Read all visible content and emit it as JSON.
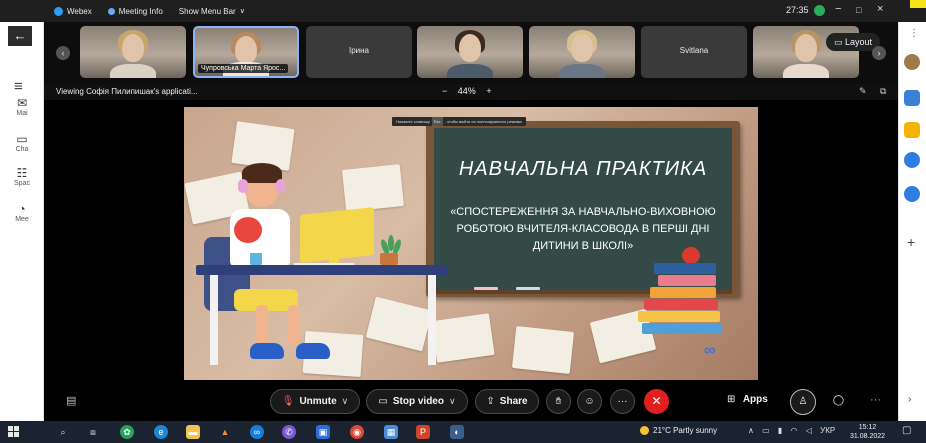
{
  "titlebar": {
    "app_name": "Webex",
    "meeting_info": "Meeting Info",
    "show_menu_bar": "Show Menu Bar",
    "timer": "27:35",
    "minimize_glyph": "−",
    "maximize_glyph": "□",
    "close_glyph": "×"
  },
  "participants": [
    {
      "name": "",
      "kind": "video",
      "hair": "#c9a46b",
      "shirt": "#d9d2c5"
    },
    {
      "name": "Чупровська Марта Ярос...",
      "kind": "video",
      "hair": "#b8895e",
      "shirt": "#f2e6da",
      "active": true
    },
    {
      "name": "Ірина",
      "kind": "name"
    },
    {
      "name": "",
      "kind": "video",
      "hair": "#3b2a20",
      "shirt": "#4b5b6a"
    },
    {
      "name": "",
      "kind": "video",
      "hair": "#d8bf8f",
      "shirt": "#6a7585"
    },
    {
      "name": "Svitlana",
      "kind": "name"
    },
    {
      "name": "",
      "kind": "video",
      "hair": "#b79466",
      "shirt": "#e6d9cd"
    }
  ],
  "layout_button": {
    "label": "Layout",
    "icon": "layout-icon"
  },
  "share": {
    "viewing_text": "Viewing Софія Пилипишак's applicati...",
    "zoom_minus": "−",
    "zoom_value": "44%",
    "zoom_plus": "+"
  },
  "slide": {
    "toast_before": "Нажмите клавишу",
    "toast_key": "Esc",
    "toast_after": ", чтобы выйти из полноэкранного режима",
    "title": "НАВЧАЛЬНА ПРАКТИКА",
    "subtitle": "«СПОСТЕРЕЖЕННЯ ЗА НАВЧАЛЬНО-ВИХОВНОЮ РОБОТОЮ ВЧИТЕЛЯ-КЛАСОВОДА В ПЕРШІ ДНІ ДИТИНИ В ШКОЛІ»"
  },
  "controls": {
    "unmute": "Unmute",
    "stop_video": "Stop video",
    "share": "Share",
    "apps": "Apps",
    "more_glyph": "···"
  },
  "left_rail": [
    {
      "label": "Mai",
      "icon": "mail-icon"
    },
    {
      "label": "Cha",
      "icon": "chat-icon"
    },
    {
      "label": "Spac",
      "icon": "spaces-icon"
    },
    {
      "label": "Mee",
      "icon": "meetings-icon"
    }
  ],
  "taskbar": {
    "weather": "21°C  Partly sunny",
    "language": "УКР",
    "time": "15:12",
    "date": "31.08.2022"
  },
  "colors": {
    "accent_active": "#8ab4f8",
    "end_call": "#e0201f",
    "board": "#334a47"
  }
}
